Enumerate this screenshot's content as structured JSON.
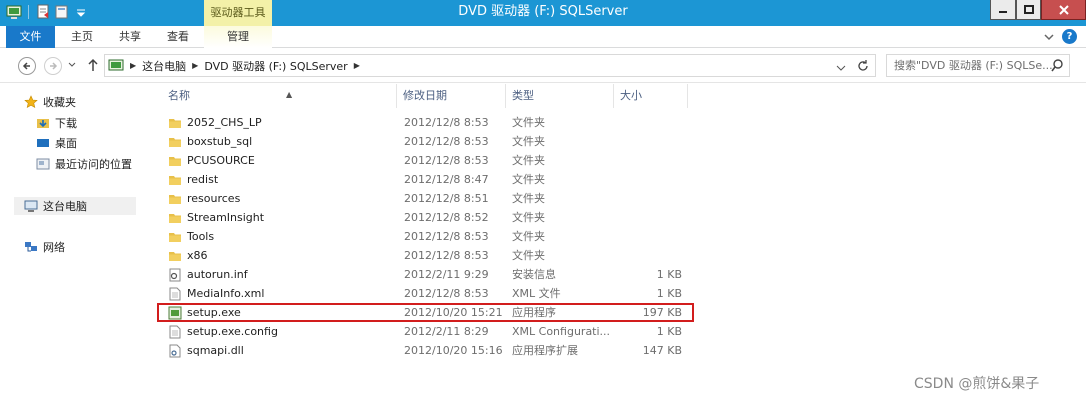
{
  "window": {
    "title": "DVD 驱动器 (F:) SQLServer",
    "context_tab_group": "驱动器工具"
  },
  "ribbon": {
    "tabs": [
      "文件",
      "主页",
      "共享",
      "查看",
      "管理"
    ]
  },
  "nav": {
    "path": [
      "这台电脑",
      "DVD 驱动器 (F:) SQLServer"
    ],
    "search_placeholder": "搜索\"DVD 驱动器 (F:) SQLSe..."
  },
  "sidebar": {
    "favorites": "收藏夹",
    "fav_items": [
      "下载",
      "桌面",
      "最近访问的位置"
    ],
    "this_pc": "这台电脑",
    "network": "网络"
  },
  "columns": {
    "name": "名称",
    "modified": "修改日期",
    "type": "类型",
    "size": "大小"
  },
  "files": [
    {
      "name": "2052_CHS_LP",
      "modified": "2012/12/8 8:53",
      "type": "文件夹",
      "size": "",
      "icon": "folder-icon"
    },
    {
      "name": "boxstub_sql",
      "modified": "2012/12/8 8:53",
      "type": "文件夹",
      "size": "",
      "icon": "folder-icon"
    },
    {
      "name": "PCUSOURCE",
      "modified": "2012/12/8 8:53",
      "type": "文件夹",
      "size": "",
      "icon": "folder-icon"
    },
    {
      "name": "redist",
      "modified": "2012/12/8 8:47",
      "type": "文件夹",
      "size": "",
      "icon": "folder-icon"
    },
    {
      "name": "resources",
      "modified": "2012/12/8 8:51",
      "type": "文件夹",
      "size": "",
      "icon": "folder-icon"
    },
    {
      "name": "StreamInsight",
      "modified": "2012/12/8 8:52",
      "type": "文件夹",
      "size": "",
      "icon": "folder-icon"
    },
    {
      "name": "Tools",
      "modified": "2012/12/8 8:53",
      "type": "文件夹",
      "size": "",
      "icon": "folder-icon"
    },
    {
      "name": "x86",
      "modified": "2012/12/8 8:53",
      "type": "文件夹",
      "size": "",
      "icon": "folder-icon"
    },
    {
      "name": "autorun.inf",
      "modified": "2012/2/11 9:29",
      "type": "安装信息",
      "size": "1 KB",
      "icon": "settings-file-icon"
    },
    {
      "name": "MediaInfo.xml",
      "modified": "2012/12/8 8:53",
      "type": "XML 文件",
      "size": "1 KB",
      "icon": "document-icon"
    },
    {
      "name": "setup.exe",
      "modified": "2012/10/20 15:21",
      "type": "应用程序",
      "size": "197 KB",
      "icon": "application-icon"
    },
    {
      "name": "setup.exe.config",
      "modified": "2012/2/11 8:29",
      "type": "XML Configurati...",
      "size": "1 KB",
      "icon": "document-icon"
    },
    {
      "name": "sqmapi.dll",
      "modified": "2012/10/20 15:16",
      "type": "应用程序扩展",
      "size": "147 KB",
      "icon": "dll-file-icon"
    }
  ],
  "highlighted_file": "setup.exe",
  "watermark": "CSDN @煎饼&果子",
  "colors": {
    "titlebar": "#1c96d4",
    "file_tab": "#1979ca",
    "highlight_border": "#d21d1d",
    "folder": "#e8c04a"
  }
}
